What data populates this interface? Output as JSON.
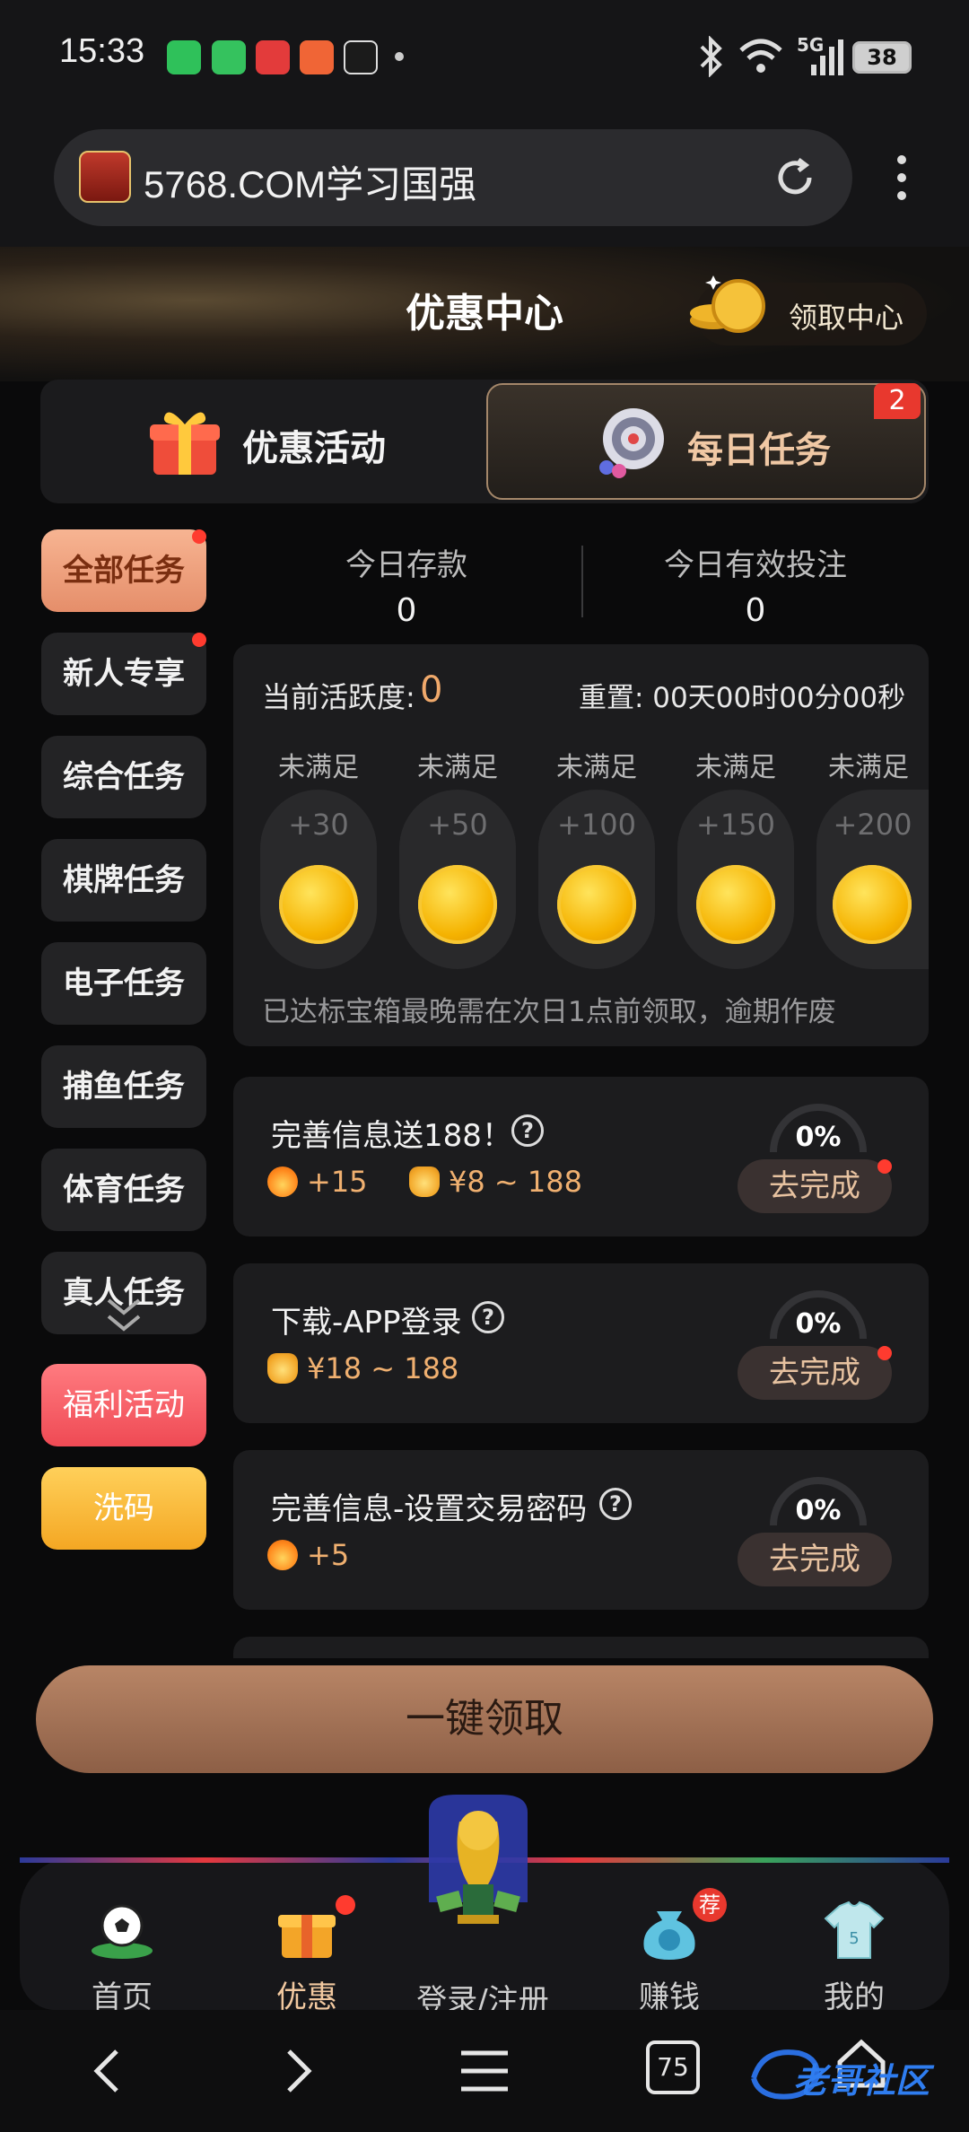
{
  "status_bar": {
    "time": "15:33",
    "signal_label": "5G",
    "battery": "38",
    "icons": [
      "wechat-icon",
      "messages-icon",
      "xiaohongshu-icon",
      "weibo-icon",
      "tiktok-icon",
      "bluetooth-icon",
      "wifi-icon"
    ]
  },
  "browser": {
    "url": "5768.COM学习国强",
    "tabs_count": "75"
  },
  "header": {
    "title": "优惠中心",
    "claim_center": "领取中心"
  },
  "tabs": [
    {
      "label": "优惠活动",
      "active": false
    },
    {
      "label": "每日任务",
      "active": true,
      "badge": "2"
    }
  ],
  "sidebar": {
    "items": [
      {
        "label": "全部任务",
        "active": true,
        "dot": true
      },
      {
        "label": "新人专享",
        "dot": true
      },
      {
        "label": "综合任务"
      },
      {
        "label": "棋牌任务"
      },
      {
        "label": "电子任务"
      },
      {
        "label": "捕鱼任务"
      },
      {
        "label": "体育任务"
      },
      {
        "label": "真人任务"
      },
      {
        "label": "福利活动"
      },
      {
        "label": "洗码"
      }
    ]
  },
  "stats": {
    "deposit_label": "今日存款",
    "deposit_value": "0",
    "bet_label": "今日有效投注",
    "bet_value": "0"
  },
  "activity": {
    "label": "当前活跃度:",
    "value": "0",
    "reset": "重置: 00天00时00分00秒",
    "milestones": [
      {
        "status": "未满足",
        "points": "+30"
      },
      {
        "status": "未满足",
        "points": "+50"
      },
      {
        "status": "未满足",
        "points": "+100"
      },
      {
        "status": "未满足",
        "points": "+150"
      },
      {
        "status": "未满足",
        "points": "+200"
      }
    ],
    "note": "已达标宝箱最晚需在次日1点前领取，逾期作废"
  },
  "tasks": [
    {
      "title": "完善信息送188！",
      "activity": "+15",
      "money": "¥8 ~ 188",
      "progress": "0%",
      "button": "去完成"
    },
    {
      "title": "下载-APP登录",
      "money": "¥18 ~ 188",
      "progress": "0%",
      "button": "去完成"
    },
    {
      "title": "完善信息-设置交易密码",
      "activity": "+5",
      "progress": "0%",
      "button": "去完成"
    }
  ],
  "one_click": "一键领取",
  "bottom_nav": {
    "items": [
      {
        "label": "首页"
      },
      {
        "label": "优惠",
        "active": true
      },
      {
        "label": "登录/注册"
      },
      {
        "label": "赚钱",
        "badge": "荐"
      },
      {
        "label": "我的"
      }
    ]
  },
  "watermark": "老哥社区",
  "colors": {
    "accent": "#f0a96b",
    "coin": "#f5b301",
    "badge_red": "#e8382e",
    "one_click": "#a87455"
  }
}
